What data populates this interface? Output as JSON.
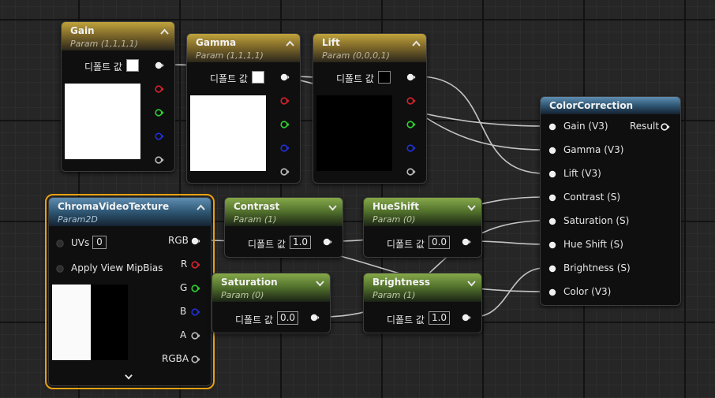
{
  "default_label": "디폴트 값",
  "gain": {
    "title": "Gain",
    "subtitle": "Param (1,1,1,1)"
  },
  "gamma": {
    "title": "Gamma",
    "subtitle": "Param (1,1,1,1)"
  },
  "lift": {
    "title": "Lift",
    "subtitle": "Param (0,0,0,1)"
  },
  "chroma": {
    "title": "ChromaVideoTexture",
    "subtitle": "Param2D",
    "uvs_label": "UVs",
    "uvs_value": "0",
    "mipbias_label": "Apply View MipBias",
    "outputs": [
      "RGB",
      "R",
      "G",
      "B",
      "A",
      "RGBA"
    ]
  },
  "contrast": {
    "title": "Contrast",
    "subtitle": "Param (1)",
    "value": "1.0"
  },
  "hueshift": {
    "title": "HueShift",
    "subtitle": "Param (0)",
    "value": "0.0"
  },
  "saturation": {
    "title": "Saturation",
    "subtitle": "Param (0)",
    "value": "0.0"
  },
  "brightness": {
    "title": "Brightness",
    "subtitle": "Param (1)",
    "value": "1.0"
  },
  "colorcorrection": {
    "title": "ColorCorrection",
    "inputs": [
      "Gain (V3)",
      "Gamma (V3)",
      "Lift (V3)",
      "Contrast (S)",
      "Saturation (S)",
      "Hue Shift (S)",
      "Brightness (S)",
      "Color (V3)"
    ],
    "output": "Result"
  },
  "colors": {
    "wire": "#d8d8d8",
    "red": "#d8222b",
    "green": "#2fd131",
    "blue": "#2030d8",
    "selection": "#e8a115"
  }
}
